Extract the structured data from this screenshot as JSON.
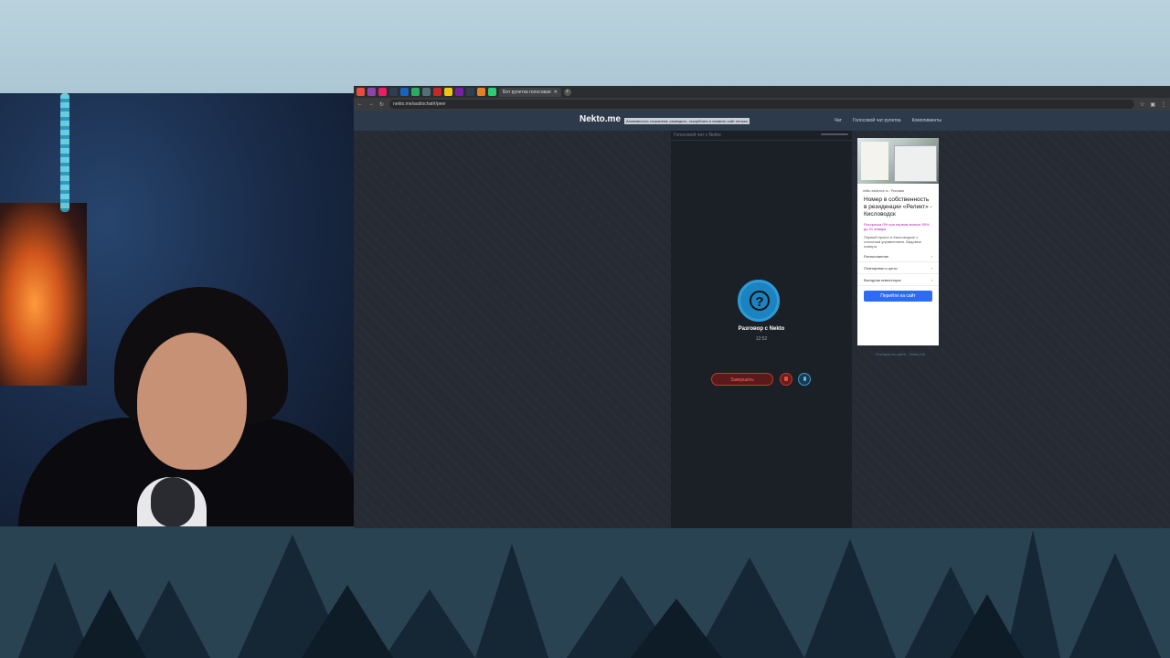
{
  "browser": {
    "active_tab_title": "Бот рулетка голосовая",
    "url": "nekto.me/audiochat#/peer",
    "tab_colors": [
      "#e74c3c",
      "#8e44ad",
      "#e91e63",
      "#2c3e50",
      "#1565c0",
      "#27ae60",
      "#546e7a",
      "#c62828",
      "#f1c40f",
      "#7b1fa2",
      "#2c3e50",
      "#e67e22",
      "#2ecc71"
    ]
  },
  "site": {
    "logo": "Nekto.me",
    "notice": "Анонимность сохранена: разводить, оскорблять и спамить сайт нельзя",
    "nav": [
      "Чат",
      "Голосовой чат рулетка",
      "Комплименты"
    ]
  },
  "chat": {
    "title": "Голосовой чат с Nekto",
    "peer_name": "Разговор с Nekto",
    "timer": "12:52",
    "end_label": "Завершить"
  },
  "ad": {
    "domain": "relikt-residence.ru",
    "badge": "Реклама",
    "title": "Номер в собственность в резиденции «Реликт» - Кисловодск",
    "promo": "Рассрочка 0% при первом взносе 50% до 31 января",
    "description": "Первый проект в Кисловодске с отельным управлением. Видовые номера.",
    "items": [
      "Расположение",
      "Планировки и цены",
      "Выгодная инвестиция"
    ],
    "cta": "Перейти на сайт",
    "note": "Реклама на сайте · Nekto.me"
  }
}
